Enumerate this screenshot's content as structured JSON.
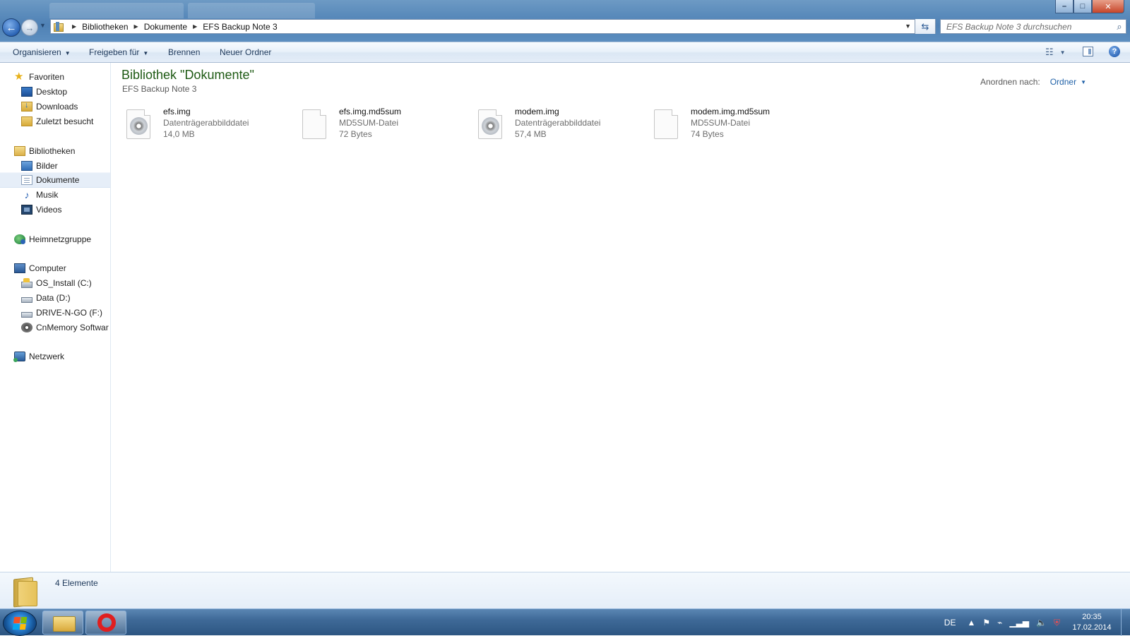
{
  "window": {
    "title_buttons": {
      "minimize": "–",
      "maximize": "□",
      "close": "✕"
    }
  },
  "nav": {
    "breadcrumb": [
      "Bibliotheken",
      "Dokumente",
      "EFS Backup Note 3"
    ],
    "search_placeholder": "EFS Backup Note 3 durchsuchen"
  },
  "toolbar": {
    "organize": "Organisieren",
    "share": "Freigeben für",
    "burn": "Brennen",
    "new_folder": "Neuer Ordner"
  },
  "sidebar": {
    "favorites": {
      "label": "Favoriten",
      "items": [
        "Desktop",
        "Downloads",
        "Zuletzt besucht"
      ]
    },
    "libraries": {
      "label": "Bibliotheken",
      "items": [
        "Bilder",
        "Dokumente",
        "Musik",
        "Videos"
      ],
      "selected": "Dokumente"
    },
    "homegroup": "Heimnetzgruppe",
    "computer": {
      "label": "Computer",
      "items": [
        "OS_Install (C:)",
        "Data (D:)",
        "DRIVE-N-GO (F:)",
        "CnMemory Softwar"
      ]
    },
    "network": "Netzwerk"
  },
  "main": {
    "title": "Bibliothek \"Dokumente\"",
    "subtitle": "EFS Backup Note 3",
    "arrange_label": "Anordnen nach:",
    "arrange_value": "Ordner",
    "files": [
      {
        "name": "efs.img",
        "type": "Datenträgerabbilddatei",
        "size": "14,0 MB",
        "icon": "disc-image-icon"
      },
      {
        "name": "efs.img.md5sum",
        "type": "MD5SUM-Datei",
        "size": "72 Bytes",
        "icon": "generic-file-icon"
      },
      {
        "name": "modem.img",
        "type": "Datenträgerabbilddatei",
        "size": "57,4 MB",
        "icon": "disc-image-icon"
      },
      {
        "name": "modem.img.md5sum",
        "type": "MD5SUM-Datei",
        "size": "74 Bytes",
        "icon": "generic-file-icon"
      }
    ]
  },
  "details": {
    "count": "4 Elemente"
  },
  "taskbar": {
    "language": "DE",
    "time": "20:35",
    "date": "17.02.2014"
  }
}
